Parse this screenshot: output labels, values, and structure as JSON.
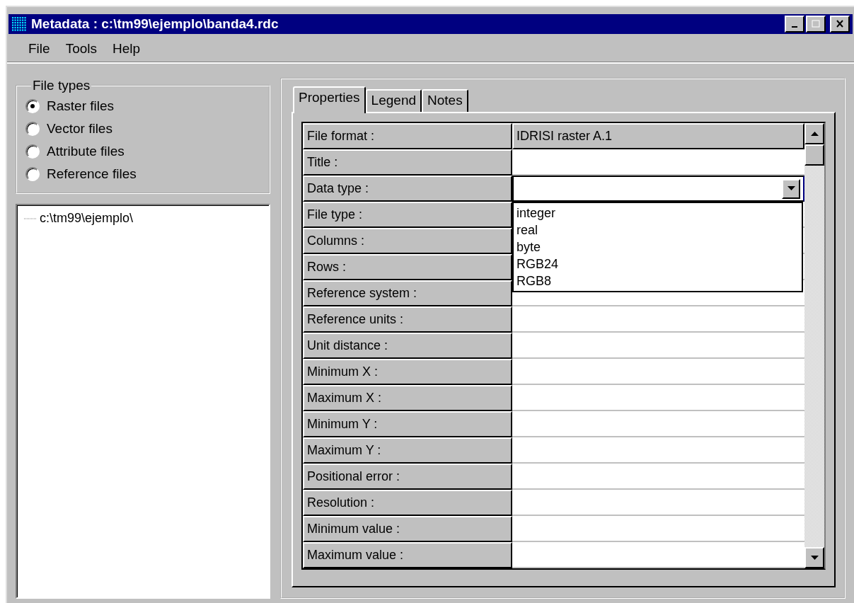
{
  "window": {
    "title": "Metadata : c:\\tm99\\ejemplo\\banda4.rdc"
  },
  "menu": [
    "File",
    "Tools",
    "Help"
  ],
  "file_types": {
    "legend": "File types",
    "options": [
      {
        "label": "Raster files",
        "selected": true
      },
      {
        "label": "Vector files",
        "selected": false
      },
      {
        "label": "Attribute files",
        "selected": false
      },
      {
        "label": "Reference files",
        "selected": false
      }
    ]
  },
  "tree": {
    "items": [
      {
        "label": "c:\\tm99\\ejemplo\\"
      }
    ]
  },
  "tabs": [
    {
      "label": "Properties",
      "selected": true
    },
    {
      "label": "Legend",
      "selected": false
    },
    {
      "label": "Notes",
      "selected": false
    }
  ],
  "properties": [
    {
      "label": "File format :",
      "kind": "readonly",
      "value": "IDRISI raster A.1"
    },
    {
      "label": "Title :",
      "kind": "text"
    },
    {
      "label": "Data type :",
      "kind": "combo",
      "options": [
        "integer",
        "real",
        "byte",
        "RGB24",
        "RGB8"
      ]
    },
    {
      "label": "File type :",
      "kind": "text"
    },
    {
      "label": "Columns :",
      "kind": "text"
    },
    {
      "label": "Rows :",
      "kind": "text"
    },
    {
      "label": "Reference system :",
      "kind": "text"
    },
    {
      "label": "Reference units :",
      "kind": "text"
    },
    {
      "label": "Unit distance :",
      "kind": "text"
    },
    {
      "label": "Minimum X :",
      "kind": "text"
    },
    {
      "label": "Maximum X :",
      "kind": "text"
    },
    {
      "label": "Minimum Y :",
      "kind": "text"
    },
    {
      "label": "Maximum Y :",
      "kind": "text"
    },
    {
      "label": "Positional error :",
      "kind": "text"
    },
    {
      "label": "Resolution :",
      "kind": "text"
    },
    {
      "label": "Minimum value :",
      "kind": "text"
    },
    {
      "label": "Maximum value :",
      "kind": "text"
    }
  ]
}
